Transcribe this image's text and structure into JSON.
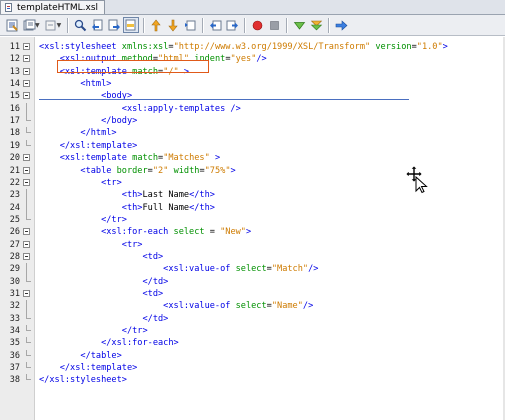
{
  "tab": {
    "label": "templateHTML.xsl",
    "icon": "xsl-file-icon"
  },
  "toolbar": {
    "buttons": [
      {
        "name": "source-view-icon"
      },
      {
        "name": "history-icon"
      },
      {
        "name": "back-icon"
      },
      {
        "name": "find-icon"
      },
      {
        "name": "find-previous-icon"
      },
      {
        "name": "find-next-icon"
      },
      {
        "name": "toggle-highlight-icon"
      },
      {
        "name": "previous-bookmark-icon"
      },
      {
        "name": "next-bookmark-icon"
      },
      {
        "name": "toggle-bookmark-icon"
      },
      {
        "name": "shift-left-icon"
      },
      {
        "name": "shift-right-icon"
      },
      {
        "name": "start-macro-icon"
      },
      {
        "name": "stop-macro-icon"
      },
      {
        "name": "check-xml-icon"
      },
      {
        "name": "validate-xml-icon"
      },
      {
        "name": "xsl-transform-icon"
      }
    ]
  },
  "editor": {
    "lines": [
      {
        "n": "11",
        "parts": [
          [
            "tag",
            "<xsl:stylesheet "
          ],
          [
            "attr",
            "xmlns:xsl"
          ],
          [
            "txt",
            "="
          ],
          [
            "val",
            "\"http://www.w3.org/1999/XSL/Transform\""
          ],
          [
            "txt",
            " "
          ],
          [
            "attr",
            "version"
          ],
          [
            "txt",
            "="
          ],
          [
            "val",
            "\"1.0\""
          ],
          [
            "tag",
            ">"
          ]
        ]
      },
      {
        "n": "12",
        "parts": [
          [
            "tag",
            "    <xsl:output "
          ],
          [
            "attr",
            "method"
          ],
          [
            "txt",
            "="
          ],
          [
            "val",
            "\"html\""
          ],
          [
            "txt",
            " "
          ],
          [
            "attr",
            "indent"
          ],
          [
            "txt",
            "="
          ],
          [
            "val",
            "\"yes\""
          ],
          [
            "tag",
            "/>"
          ]
        ]
      },
      {
        "n": "13",
        "parts": [
          [
            "tag",
            "    <xsl:template "
          ],
          [
            "attr",
            "match"
          ],
          [
            "txt",
            "="
          ],
          [
            "val",
            "\"/\""
          ],
          [
            "tag",
            " >"
          ]
        ]
      },
      {
        "n": "14",
        "parts": [
          [
            "tag",
            "        <html>"
          ]
        ]
      },
      {
        "n": "15",
        "parts": [
          [
            "tag",
            "            <body>"
          ]
        ]
      },
      {
        "n": "16",
        "parts": [
          [
            "tag",
            "                <xsl:apply-templates />"
          ]
        ]
      },
      {
        "n": "17",
        "parts": [
          [
            "tag",
            "            </body>"
          ]
        ]
      },
      {
        "n": "18",
        "parts": [
          [
            "tag",
            "        </html>"
          ]
        ]
      },
      {
        "n": "19",
        "parts": [
          [
            "tag",
            "    </xsl:template>"
          ]
        ]
      },
      {
        "n": "20",
        "parts": [
          [
            "tag",
            "    <xsl:template "
          ],
          [
            "attr",
            "match"
          ],
          [
            "txt",
            "="
          ],
          [
            "val",
            "\"Matches\""
          ],
          [
            "tag",
            " >"
          ]
        ]
      },
      {
        "n": "21",
        "parts": [
          [
            "tag",
            "        <table "
          ],
          [
            "attr",
            "border"
          ],
          [
            "txt",
            "="
          ],
          [
            "val",
            "\"2\""
          ],
          [
            "txt",
            " "
          ],
          [
            "attr",
            "width"
          ],
          [
            "txt",
            "="
          ],
          [
            "val",
            "\"75%\""
          ],
          [
            "tag",
            ">"
          ]
        ]
      },
      {
        "n": "22",
        "parts": [
          [
            "tag",
            "            <tr>"
          ]
        ]
      },
      {
        "n": "23",
        "parts": [
          [
            "tag",
            "                <th>"
          ],
          [
            "txt",
            "Last Name"
          ],
          [
            "tag",
            "</th>"
          ]
        ]
      },
      {
        "n": "24",
        "parts": [
          [
            "tag",
            "                <th>"
          ],
          [
            "txt",
            "Full Name"
          ],
          [
            "tag",
            "</th>"
          ]
        ]
      },
      {
        "n": "25",
        "parts": [
          [
            "tag",
            "            </tr>"
          ]
        ]
      },
      {
        "n": "26",
        "parts": [
          [
            "tag",
            "            <xsl:for-each "
          ],
          [
            "attr",
            "select"
          ],
          [
            "txt",
            " = "
          ],
          [
            "val",
            "\"New\""
          ],
          [
            "tag",
            ">"
          ]
        ]
      },
      {
        "n": "27",
        "parts": [
          [
            "tag",
            "                <tr>"
          ]
        ]
      },
      {
        "n": "28",
        "parts": [
          [
            "tag",
            "                    <td>"
          ]
        ]
      },
      {
        "n": "29",
        "parts": [
          [
            "tag",
            "                        <xsl:value-of "
          ],
          [
            "attr",
            "select"
          ],
          [
            "txt",
            "="
          ],
          [
            "val",
            "\"Match\""
          ],
          [
            "tag",
            "/>"
          ]
        ]
      },
      {
        "n": "30",
        "parts": [
          [
            "tag",
            "                    </td>"
          ]
        ]
      },
      {
        "n": "31",
        "parts": [
          [
            "tag",
            "                    <td>"
          ]
        ]
      },
      {
        "n": "32",
        "parts": [
          [
            "tag",
            "                        <xsl:value-of "
          ],
          [
            "attr",
            "select"
          ],
          [
            "txt",
            "="
          ],
          [
            "val",
            "\"Name\""
          ],
          [
            "tag",
            "/>"
          ]
        ]
      },
      {
        "n": "33",
        "parts": [
          [
            "tag",
            "                    </td>"
          ]
        ]
      },
      {
        "n": "34",
        "parts": [
          [
            "tag",
            "                </tr>"
          ]
        ]
      },
      {
        "n": "35",
        "parts": [
          [
            "tag",
            "            </xsl:for-each>"
          ]
        ]
      },
      {
        "n": "36",
        "parts": [
          [
            "tag",
            "        </table>"
          ]
        ]
      },
      {
        "n": "37",
        "parts": [
          [
            "tag",
            "    </xsl:template>"
          ]
        ]
      },
      {
        "n": "38",
        "parts": [
          [
            "tag",
            "</xsl:stylesheet>"
          ]
        ]
      }
    ]
  },
  "colors": {
    "tag": "#0000e6",
    "attribute": "#009000",
    "value": "#ce7b00",
    "highlight_box": "#e05a1a"
  },
  "cursor": {
    "icon": "move-cursor-icon"
  }
}
